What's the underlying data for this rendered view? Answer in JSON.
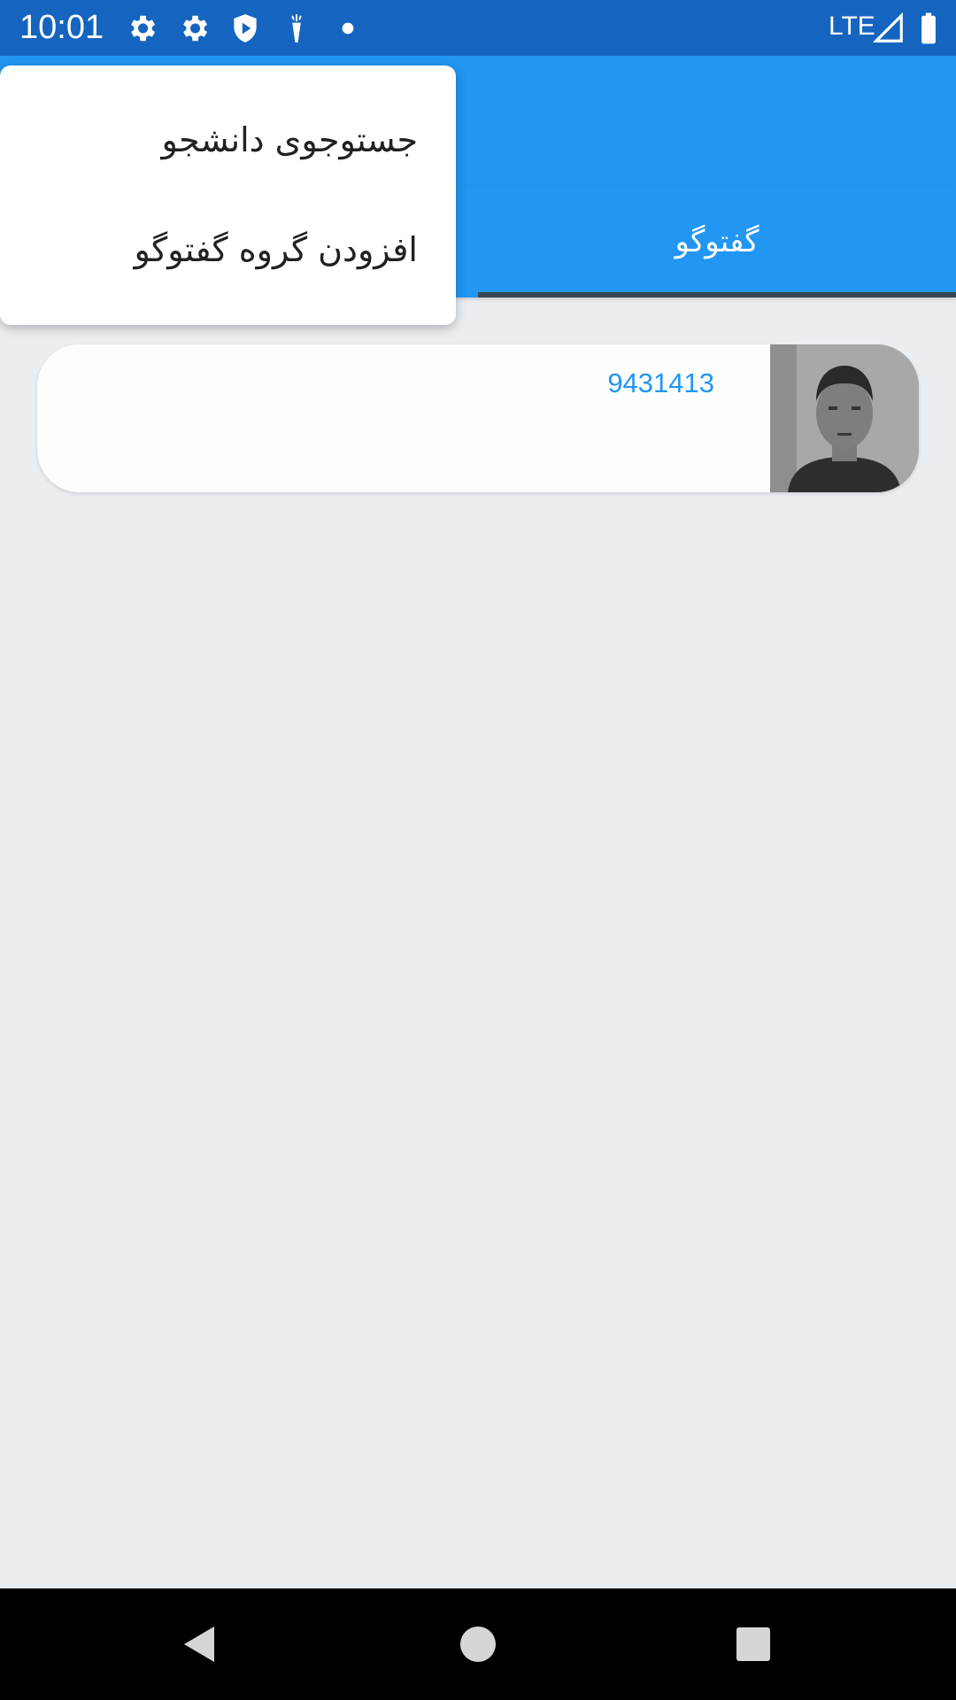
{
  "status_bar": {
    "time": "10:01",
    "network": "LTE",
    "icons": [
      "gear-icon",
      "gear-icon",
      "shield-play-icon",
      "carrot-icon",
      "dot-icon",
      "signal-icon",
      "battery-icon"
    ]
  },
  "tabs": {
    "chat_label": "گفتوگو"
  },
  "chats": [
    {
      "title": "9431413",
      "avatar": "user-photo"
    }
  ],
  "popup_menu": {
    "items": [
      {
        "label": "جستوجوی دانشجو"
      },
      {
        "label": "افزودن گروه گفتوگو"
      }
    ]
  },
  "nav_bar": {
    "buttons": [
      "back-icon",
      "home-icon",
      "recents-icon"
    ]
  },
  "colors": {
    "status_bar": "#1565C0",
    "primary": "#2196F3",
    "background": "#EBEEF1",
    "tab_indicator": "#37474F"
  }
}
